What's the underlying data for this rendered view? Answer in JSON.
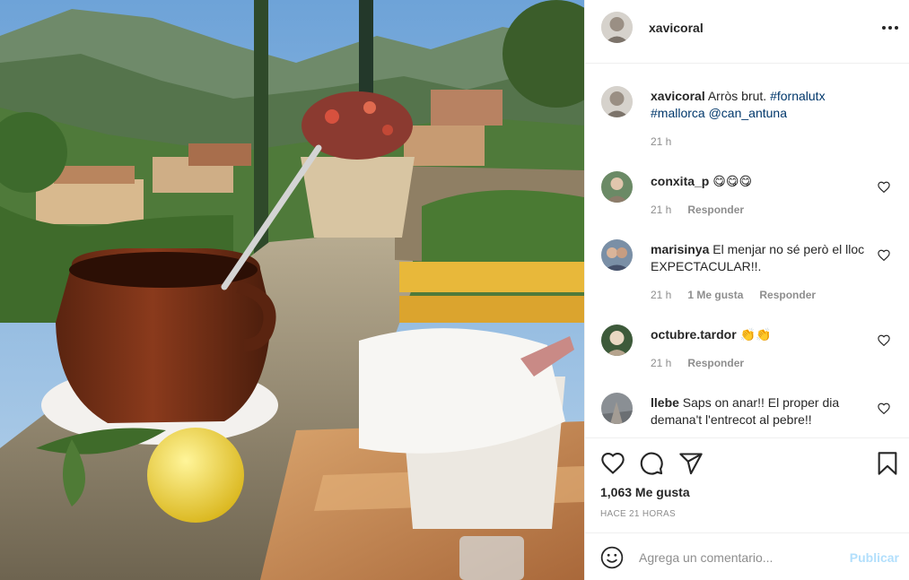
{
  "colors": {
    "link": "#00376b",
    "muted": "#8e8e8e",
    "text": "#262626",
    "publish_disabled": "#b2dffc",
    "divider": "#efefef"
  },
  "post": {
    "author": "xavicoral",
    "menu_icon": "more-horizontal-icon",
    "caption": {
      "user": "xavicoral",
      "text": "Arròs brut.",
      "tags": [
        "#fornalutx",
        "#mallorca",
        "@can_antuna"
      ],
      "time": "21 h"
    },
    "likes_label": "1,063 Me gusta",
    "posted_ago": "HACE 21 HORAS"
  },
  "comments": [
    {
      "user": "conxita_p",
      "text": "😋😋😋",
      "time": "21 h",
      "likes": "",
      "reply": "Responder"
    },
    {
      "user": "marisinya",
      "text": "El menjar no sé però el lloc EXPECTACULAR!!.",
      "time": "21 h",
      "likes": "1 Me gusta",
      "reply": "Responder"
    },
    {
      "user": "octubre.tardor",
      "text": "👏👏",
      "time": "21 h",
      "likes": "",
      "reply": "Responder"
    },
    {
      "user": "llebe",
      "text": "Saps on anar!! El proper dia demana't l'entrecot al pebre!!",
      "time": "",
      "likes": "",
      "reply": ""
    }
  ],
  "actions": {
    "icons": [
      "heart-icon",
      "comment-icon",
      "share-icon",
      "bookmark-icon"
    ]
  },
  "composer": {
    "placeholder": "Agrega un comentario...",
    "publish_label": "Publicar",
    "emoji_icon": "emoji-icon"
  }
}
